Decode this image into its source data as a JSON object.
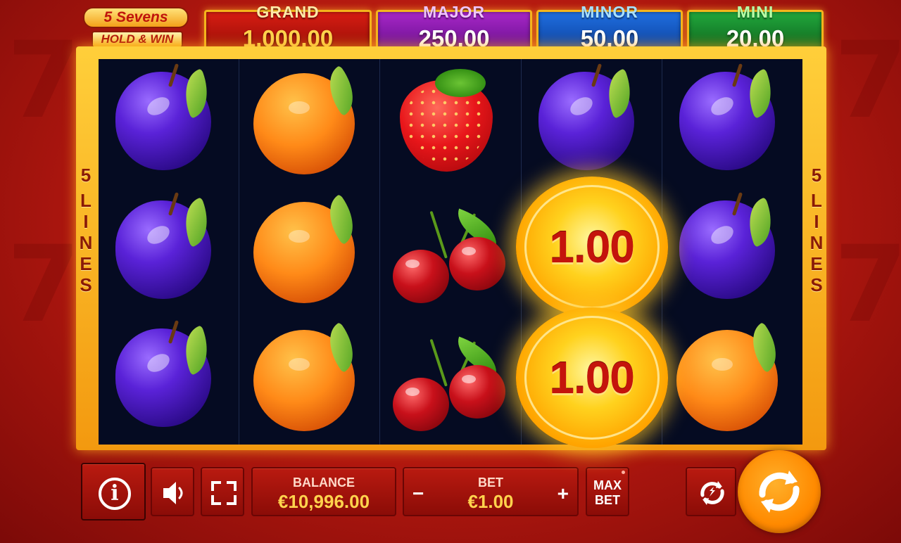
{
  "logo": {
    "line1": "5 Sevens",
    "line2": "HOLD & WIN"
  },
  "jackpots": {
    "grand": {
      "label": "GRAND",
      "value": "1,000.00"
    },
    "major": {
      "label": "MAJOR",
      "value": "250.00"
    },
    "minor": {
      "label": "MINOR",
      "value": "50.00"
    },
    "mini": {
      "label": "MINI",
      "value": "20.00"
    }
  },
  "lines_label": {
    "count": "5",
    "word": "LINES"
  },
  "reels": [
    [
      "plum",
      "plum",
      "plum"
    ],
    [
      "orange",
      "orange",
      "orange"
    ],
    [
      "strawberry",
      "cherry",
      "cherry"
    ],
    [
      "plum",
      "coin",
      "coin"
    ],
    [
      "plum",
      "plum",
      "orange"
    ]
  ],
  "coins": {
    "reel4_row2": "1.00",
    "reel4_row3": "1.00"
  },
  "controls": {
    "info_icon": "i",
    "balance_label": "BALANCE",
    "balance_value": "€10,996.00",
    "bet_label": "BET",
    "bet_value": "€1.00",
    "bet_minus": "−",
    "bet_plus": "+",
    "maxbet_line1": "MAX",
    "maxbet_line2": "BET"
  },
  "colors": {
    "background": "#b0170f",
    "frame": "#f3a018",
    "reel_bg": "#050b22",
    "grand": "#d81d12",
    "major": "#a827c8",
    "minor": "#1f6fe0",
    "mini": "#21a83c",
    "spin": "#ff8a00"
  }
}
